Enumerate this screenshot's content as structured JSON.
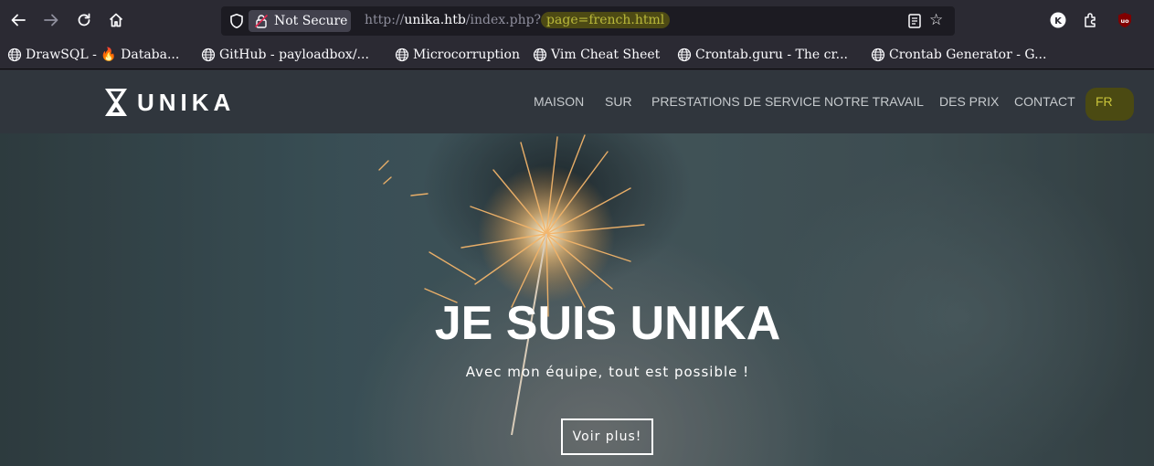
{
  "browser": {
    "security_label": "Not Secure",
    "url": {
      "scheme": "http://",
      "host": "unika.htb",
      "path": "/index.php?",
      "query": "page=french.html"
    },
    "bookmarks": [
      {
        "label": "DrawSQL - 🔥 Databa..."
      },
      {
        "label": "GitHub - payloadbox/..."
      },
      {
        "label": "Microcorruption"
      },
      {
        "label": "Vim Cheat Sheet"
      },
      {
        "label": "Crontab.guru - The cr..."
      },
      {
        "label": "Crontab Generator - G..."
      }
    ],
    "extensions": [
      {
        "icon": "k-extension-icon",
        "label": "K"
      },
      {
        "icon": "ublock-origin-icon",
        "label": "uo"
      }
    ],
    "colors": {
      "toolbar": "#2b2a33",
      "urlbar": "#1c1b22",
      "highlight": "#4d4a14"
    }
  },
  "site": {
    "logo_text": "UNIKA",
    "menu": [
      {
        "label": "MAISON"
      },
      {
        "label": "SUR"
      },
      {
        "label": "PRESTATIONS DE SERVICE"
      },
      {
        "label": "NOTRE TRAVAIL"
      },
      {
        "label": "DES PRIX"
      },
      {
        "label": "CONTACT"
      },
      {
        "label": "FR"
      }
    ],
    "hero": {
      "title": "JE SUIS UNIKA",
      "subtitle": "Avec mon équipe, tout est possible !",
      "button": "Voir plus!"
    }
  }
}
